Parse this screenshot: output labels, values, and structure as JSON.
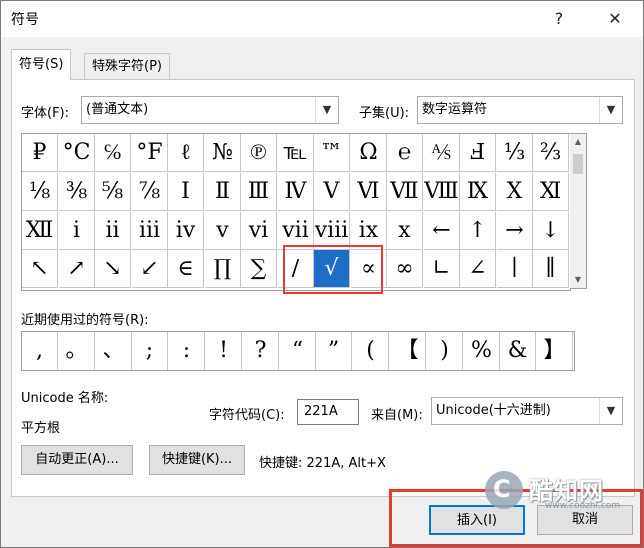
{
  "window": {
    "title": "符号",
    "help_glyph": "?",
    "close_glyph": "✕"
  },
  "tabs": [
    {
      "label": "符号(S)"
    },
    {
      "label": "特殊字符(P)"
    }
  ],
  "font": {
    "label": "字体(F):",
    "value": "(普通文本)"
  },
  "subset": {
    "label": "子集(U):",
    "value": "数字运算符"
  },
  "symbols": [
    [
      "₽",
      "°C",
      "℅",
      "°F",
      "ℓ",
      "№",
      "℗",
      "℡",
      "™",
      "Ω",
      "℮",
      "⅍",
      "Ⅎ",
      "⅓",
      "⅔"
    ],
    [
      "⅛",
      "⅜",
      "⅝",
      "⅞",
      "Ⅰ",
      "Ⅱ",
      "Ⅲ",
      "Ⅳ",
      "Ⅴ",
      "Ⅵ",
      "Ⅶ",
      "Ⅷ",
      "Ⅸ",
      "Ⅹ",
      "Ⅺ"
    ],
    [
      "Ⅻ",
      "ⅰ",
      "ⅱ",
      "ⅲ",
      "ⅳ",
      "ⅴ",
      "ⅵ",
      "ⅶ",
      "ⅷ",
      "ⅸ",
      "ⅹ",
      "←",
      "↑",
      "→",
      "↓"
    ],
    [
      "↖",
      "↗",
      "↘",
      "↙",
      "∈",
      "∏",
      "∑",
      "∕",
      "√",
      "∝",
      "∞",
      "∟",
      "∠",
      "∣",
      "∥"
    ]
  ],
  "selected_symbol": "√",
  "recent": {
    "label": "近期使用过的符号(R):",
    "symbols": [
      ",",
      "。",
      "、",
      ";",
      ":",
      "!",
      "?",
      "“",
      "”",
      "(",
      "【",
      ")",
      "%",
      "&",
      "】"
    ]
  },
  "unicode_name": {
    "label": "Unicode 名称:",
    "value": "平方根"
  },
  "char_code": {
    "label": "字符代码(C):",
    "value": "221A"
  },
  "from": {
    "label": "来自(M):",
    "value": "Unicode(十六进制)"
  },
  "buttons": {
    "autocorrect": "自动更正(A)...",
    "shortcut": "快捷键(K)...",
    "insert": "插入(I)",
    "cancel": "取消"
  },
  "shortcut_text": "快捷键: 221A, Alt+X",
  "watermark": {
    "text": "酷知网",
    "url": "www.coozhi.com"
  }
}
